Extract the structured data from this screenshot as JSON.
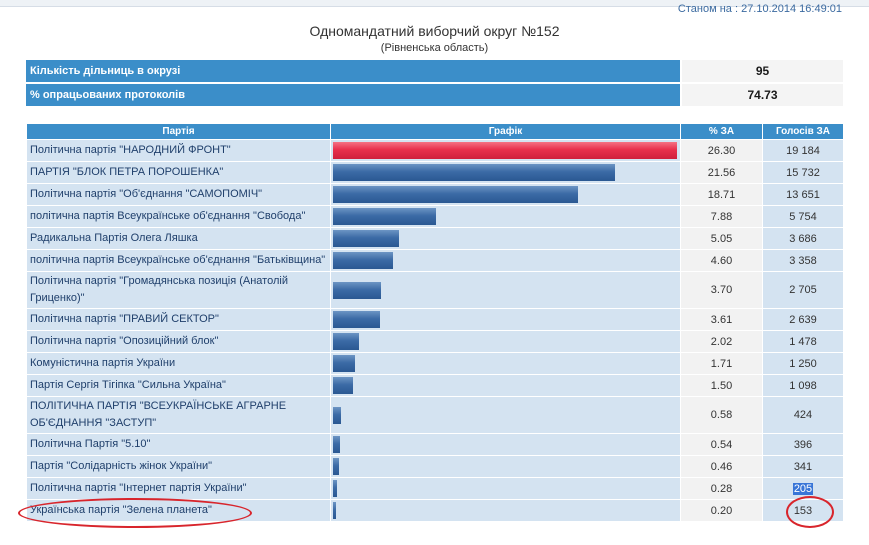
{
  "header": {
    "timestamp": "Станом на : 27.10.2014 16:49:01",
    "title": "Одномандатний виборчий округ №152",
    "subtitle": "(Рівненська область)"
  },
  "summary": [
    {
      "label": "Кількість дільниць в окрузі",
      "value": "95"
    },
    {
      "label": "% опрацьованих протоколів",
      "value": "74.73"
    }
  ],
  "columns": {
    "party": "Партія",
    "chart": "Графік",
    "pct": "% ЗА",
    "votes": "Голосів ЗА"
  },
  "rows": [
    {
      "party": "Політична партія \"НАРОДНИЙ ФРОНТ\"",
      "pct": "26.30",
      "votes": "19 184"
    },
    {
      "party": "ПАРТІЯ \"БЛОК ПЕТРА ПОРОШЕНКА\"",
      "pct": "21.56",
      "votes": "15 732"
    },
    {
      "party": "Політична партія \"Об'єднання \"САМОПОМІЧ\"",
      "pct": "18.71",
      "votes": "13 651"
    },
    {
      "party": "політична партія Всеукраїнське об'єднання \"Свобода\"",
      "pct": "7.88",
      "votes": "5 754"
    },
    {
      "party": "Радикальна Партія Олега Ляшка",
      "pct": "5.05",
      "votes": "3 686"
    },
    {
      "party": "політична партія Всеукраїнське об'єднання \"Батьківщина\"",
      "pct": "4.60",
      "votes": "3 358"
    },
    {
      "party": "Політична партія \"Громадянська позиція (Анатолій Гриценко)\"",
      "pct": "3.70",
      "votes": "2 705"
    },
    {
      "party": "Політична партія \"ПРАВИЙ СЕКТОР\"",
      "pct": "3.61",
      "votes": "2 639"
    },
    {
      "party": "Політична партія \"Опозиційний блок\"",
      "pct": "2.02",
      "votes": "1 478"
    },
    {
      "party": "Комуністична партія України",
      "pct": "1.71",
      "votes": "1 250"
    },
    {
      "party": "Партія Сергія Тігіпка \"Сильна Україна\"",
      "pct": "1.50",
      "votes": "1 098"
    },
    {
      "party": "ПОЛІТИЧНА ПАРТІЯ \"ВСЕУКРАЇНСЬКЕ АГРАРНЕ ОБ'ЄДНАННЯ \"ЗАСТУП\"",
      "pct": "0.58",
      "votes": "424"
    },
    {
      "party": "Політична Партія \"5.10\"",
      "pct": "0.54",
      "votes": "396"
    },
    {
      "party": "Партія \"Солідарність жінок України\"",
      "pct": "0.46",
      "votes": "341"
    },
    {
      "party": "Політична партія \"Інтернет партія України\"",
      "pct": "0.28",
      "votes": "205"
    },
    {
      "party": "Українська партія \"Зелена планета\"",
      "pct": "0.20",
      "votes": "153"
    }
  ],
  "colors": {
    "header_bg": "#3b8ec9",
    "cell_bg": "#d4e3f1",
    "bar_blue": "#3c6ba6",
    "bar_top": "#e8304c",
    "annotation": "#d8252c"
  }
}
